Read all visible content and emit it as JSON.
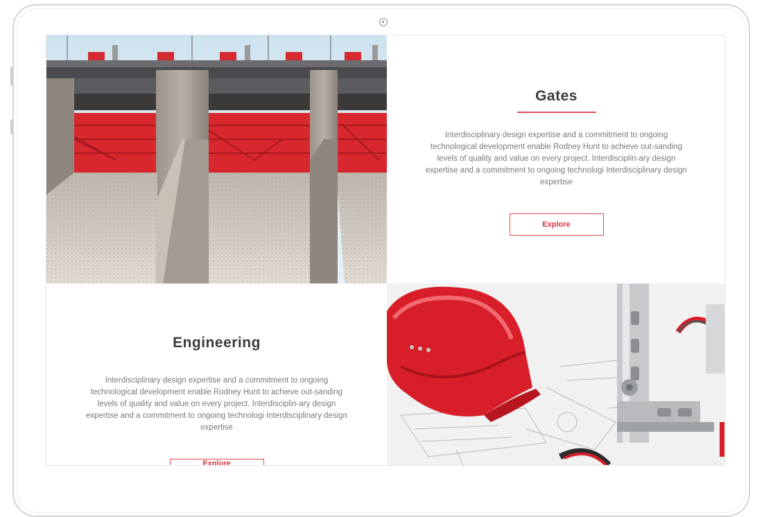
{
  "sections": [
    {
      "title": "Gates",
      "description": "Interdisciplinary design expertise  and a commitment to ongoing technological  development  enable Rodney Hunt to achieve out-sanding levels of quality and value on every project. Interdisciplin-ary design expertise  and a commitment to ongoing technologi Interdisciplinary design expertise",
      "button_label": "Explore",
      "image": "dam-gates-photo"
    },
    {
      "title": "Engineering",
      "description": "Interdisciplinary design expertise  and a commitment to ongoing technological  development  enable Rodney Hunt to achieve out-sanding levels of quality and value on every project. Interdisciplin-ary design expertise  and a commitment to ongoing technologi Interdisciplinary design expertise",
      "button_label": "Explore",
      "image": "hard-hat-blueprint-photo"
    }
  ],
  "colors": {
    "accent": "#e44a52",
    "heading": "#3b3b3b",
    "body_text": "#7a7a7a",
    "gate_red": "#d8272d"
  }
}
